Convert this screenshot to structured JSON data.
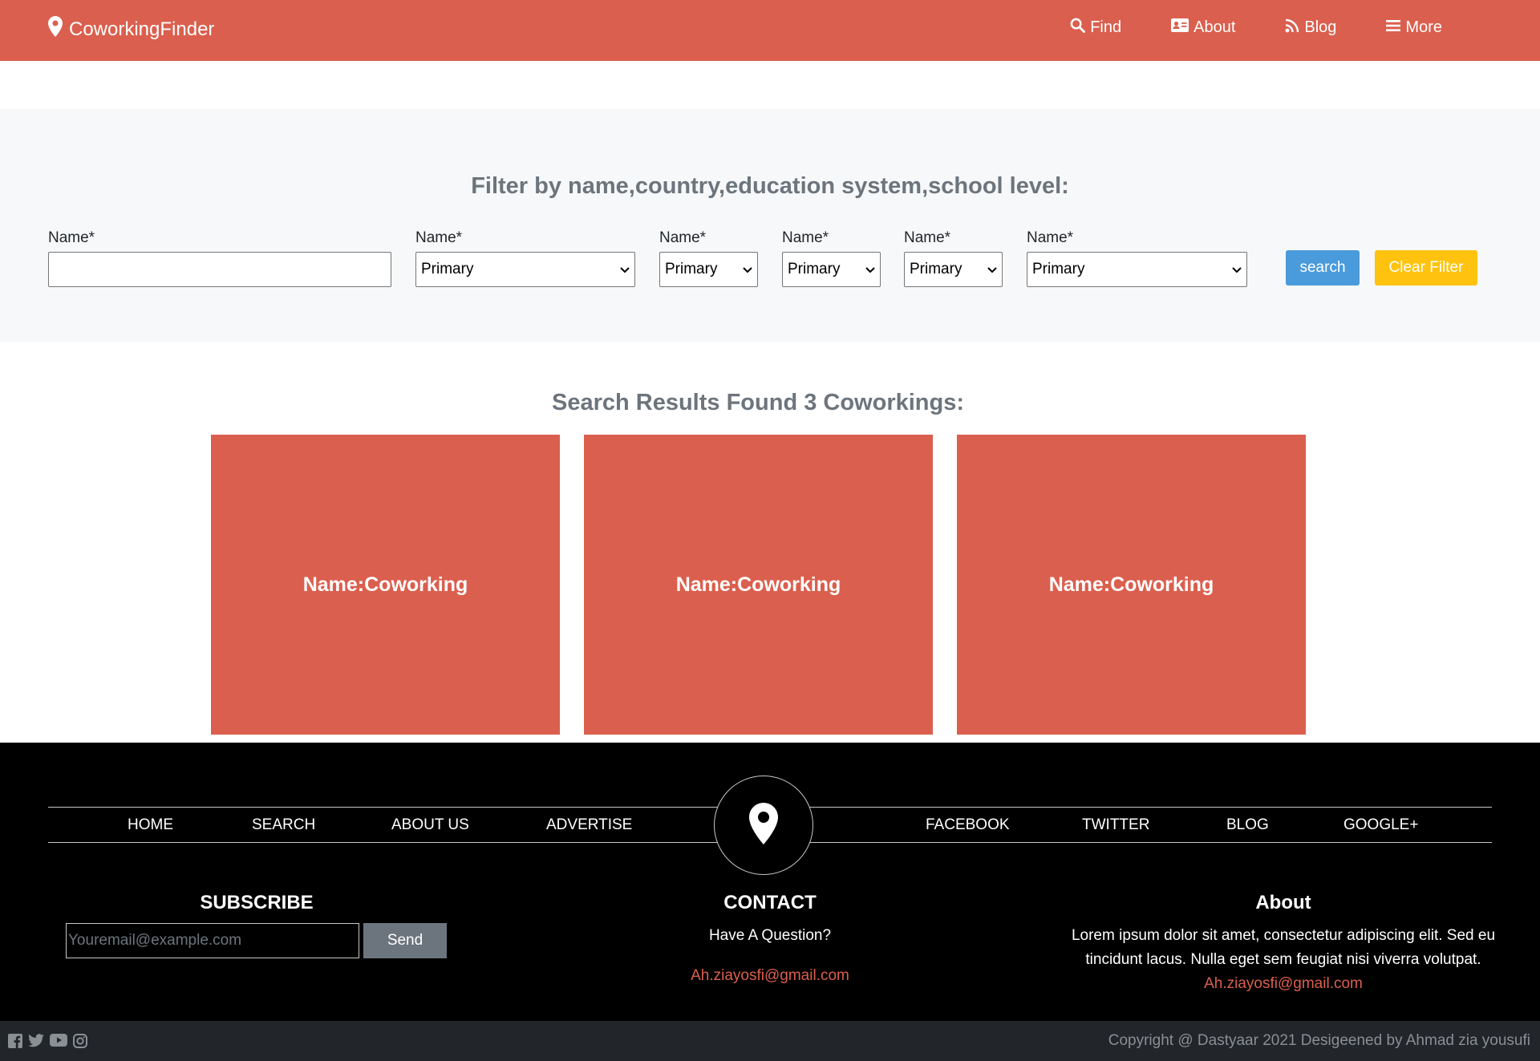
{
  "navbar": {
    "brand": "CoworkingFinder",
    "links": [
      {
        "label": "Find",
        "icon": "search-icon"
      },
      {
        "label": "About",
        "icon": "id-card-icon"
      },
      {
        "label": "Blog",
        "icon": "rss-icon"
      },
      {
        "label": "More",
        "icon": "menu-icon"
      }
    ],
    "color": "#db5f4e"
  },
  "filter": {
    "title": "Filter by name,country,education system,school level:",
    "fields": [
      {
        "label": "Name*",
        "value": ""
      },
      {
        "label": "Name*",
        "value": "Primary"
      },
      {
        "label": "Name*",
        "value": "Primary"
      },
      {
        "label": "Name*",
        "value": "Primary"
      },
      {
        "label": "Name*",
        "value": "Primary"
      },
      {
        "label": "Name*",
        "value": "Primary"
      }
    ],
    "search_label": "search",
    "clear_label": "Clear Filter"
  },
  "results": {
    "title": "Search Results Found 3 Coworkings:",
    "cards": [
      "Name:Coworking",
      "Name:Coworking",
      "Name:Coworking"
    ]
  },
  "footer": {
    "nav_left": [
      "HOME",
      "SEARCH",
      "ABOUT US",
      "ADVERTISE"
    ],
    "nav_right": [
      "FACEBOOK",
      "TWITTER",
      "BLOG",
      "GOOGLE+"
    ],
    "subscribe": {
      "title": "SUBSCRIBE",
      "placeholder": "Youremail@example.com",
      "button": "Send"
    },
    "contact": {
      "title": "CONTACT",
      "question": "Have A Question?",
      "email": "Ah.ziayosfi@gmail.com"
    },
    "about": {
      "title": "About",
      "line1": "Lorem ipsum dolor sit amet, consectetur adipiscing elit. Sed eu",
      "line2": "tincidunt lacus. Nulla eget sem feugiat nisi viverra volutpat.",
      "email": "Ah.ziayosfi@gmail.com"
    },
    "social_icons": [
      "facebook-icon",
      "twitter-icon",
      "youtube-icon",
      "instagram-icon"
    ],
    "copyright": "Copyright @ Dastyaar 2021 Desigeened by Ahmad zia yousufi"
  }
}
